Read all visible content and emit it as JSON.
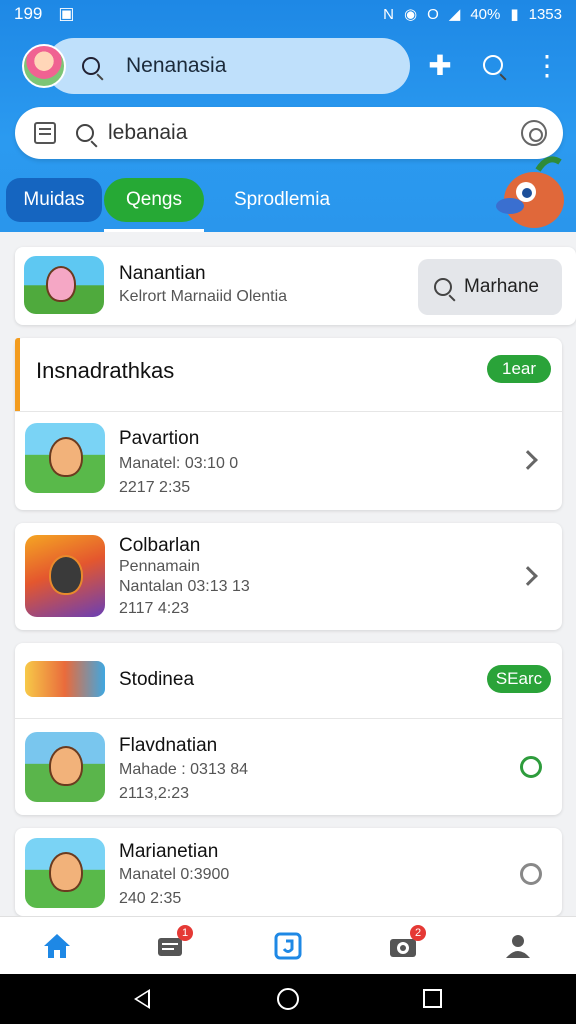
{
  "status_bar": {
    "time": "199",
    "battery_text": "40%",
    "clock_right": "1353"
  },
  "top_search": {
    "text": "Nenanasia"
  },
  "secondary_search": {
    "text": "lebanaia"
  },
  "tabs": [
    {
      "label": "Muidas"
    },
    {
      "label": "Qengs"
    },
    {
      "label": "Sprodlemia"
    }
  ],
  "featured": {
    "title": "Nanantian",
    "subtitle": "Kelrort Marnaiid Olentia",
    "button_label": "Marhane"
  },
  "section1": {
    "title": "Insnadrathkas",
    "pill": "1ear",
    "rows": [
      {
        "title": "Pavartion",
        "subtitle": "Manatel: 03:10 0",
        "time": "2217 2:35"
      },
      {
        "title": "Colbarlan",
        "subtitle": "Pennamain",
        "subtitle2": "Nantalan 03:13 13",
        "time": "2117 4:23"
      }
    ]
  },
  "section2": {
    "title": "Stodinea",
    "pill": "SEarc",
    "rows": [
      {
        "title": "Flavdnatian",
        "subtitle": "Mahade : 0313 84",
        "time": "2113,2:23"
      },
      {
        "title": "Marianetian",
        "subtitle": "Manatel 0:3900",
        "time": "240 2:35"
      }
    ]
  },
  "bottom_nav": {
    "badge_messages": "1",
    "badge_camera": "2"
  },
  "colors": {
    "header_blue": "#1e88e5",
    "green": "#2aa339",
    "orange": "#f39c1f"
  }
}
